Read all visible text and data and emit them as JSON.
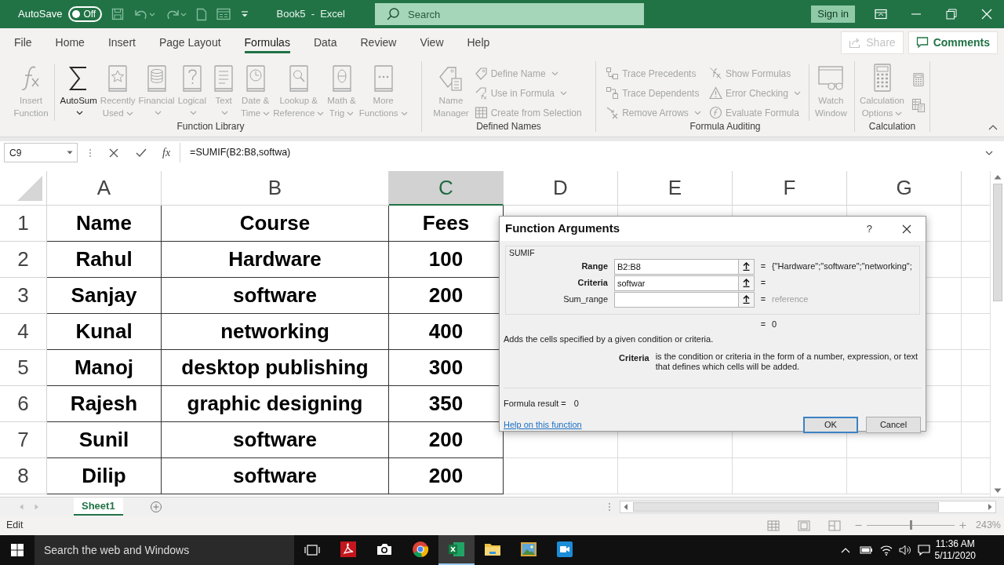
{
  "title_bar": {
    "autosave_label": "AutoSave",
    "autosave": {
      "label": "Off",
      "on": false
    },
    "document_title": "Book5  -  Excel",
    "search": {
      "placeholder": "Search"
    },
    "sign_in": "Sign in"
  },
  "ribbon_tabs": [
    {
      "label": "File",
      "selected": false
    },
    {
      "label": "Home",
      "selected": false
    },
    {
      "label": "Insert",
      "selected": false
    },
    {
      "label": "Page Layout",
      "selected": false
    },
    {
      "label": "Formulas",
      "selected": true
    },
    {
      "label": "Data",
      "selected": false
    },
    {
      "label": "Review",
      "selected": false
    },
    {
      "label": "View",
      "selected": false
    },
    {
      "label": "Help",
      "selected": false
    }
  ],
  "share": {
    "label": "Share",
    "disabled": true
  },
  "comments": {
    "label": "Comments"
  },
  "ribbon_groups": [
    {
      "label": "Function Library",
      "items": [
        {
          "kind": "large",
          "label": "Insert\nFunction",
          "disabled": true,
          "dropdown": false
        },
        {
          "kind": "divider"
        },
        {
          "kind": "large",
          "label": "AutoSum",
          "disabled": false,
          "dropdown": true
        },
        {
          "kind": "large",
          "label": "Recently\nUsed",
          "disabled": true,
          "dropdown": true
        },
        {
          "kind": "large",
          "label": "Financial",
          "disabled": true,
          "dropdown": true
        },
        {
          "kind": "large",
          "label": "Logical",
          "disabled": true,
          "dropdown": true
        },
        {
          "kind": "large",
          "label": "Text",
          "disabled": true,
          "dropdown": true
        },
        {
          "kind": "large",
          "label": "Date &\nTime",
          "disabled": true,
          "dropdown": true
        },
        {
          "kind": "large",
          "label": "Lookup &\nReference",
          "disabled": true,
          "dropdown": true
        },
        {
          "kind": "large",
          "label": "Math &\nTrig",
          "disabled": true,
          "dropdown": true
        },
        {
          "kind": "large",
          "label": "More\nFunctions",
          "disabled": true,
          "dropdown": true
        }
      ]
    },
    {
      "label": "Defined Names",
      "items": [
        {
          "kind": "large",
          "label": "Name\nManager",
          "disabled": true,
          "dropdown": false
        },
        {
          "kind": "stack",
          "items": [
            {
              "label": "Define Name",
              "disabled": true,
              "dropdown": true
            },
            {
              "label": "Use in Formula",
              "disabled": true,
              "dropdown": true
            },
            {
              "label": "Create from Selection",
              "disabled": true,
              "dropdown": false
            }
          ]
        }
      ]
    },
    {
      "label": "Formula Auditing",
      "items": [
        {
          "kind": "stack",
          "items": [
            {
              "label": "Trace Precedents",
              "disabled": true,
              "dropdown": false
            },
            {
              "label": "Trace Dependents",
              "disabled": true,
              "dropdown": false
            },
            {
              "label": "Remove Arrows",
              "disabled": true,
              "dropdown": true
            }
          ]
        },
        {
          "kind": "stack",
          "items": [
            {
              "label": "Show Formulas",
              "disabled": true,
              "dropdown": false
            },
            {
              "label": "Error Checking",
              "disabled": true,
              "dropdown": true
            },
            {
              "label": "Evaluate Formula",
              "disabled": true,
              "dropdown": false
            }
          ]
        },
        {
          "kind": "divider"
        },
        {
          "kind": "large",
          "label": "Watch\nWindow",
          "disabled": true,
          "dropdown": false
        }
      ]
    },
    {
      "label": "Calculation",
      "items": [
        {
          "kind": "large",
          "label": "Calculation\nOptions",
          "disabled": true,
          "dropdown": true
        },
        {
          "kind": "icon_stack"
        }
      ]
    }
  ],
  "formula_bar": {
    "name_box": "C9",
    "fx_label": "fx",
    "formula": "=SUMIF(B2:B8,softwa)"
  },
  "sheet": {
    "columns": [
      {
        "label": "A",
        "selected": false
      },
      {
        "label": "B",
        "selected": false
      },
      {
        "label": "C",
        "selected": true
      },
      {
        "label": "D",
        "selected": false
      },
      {
        "label": "E",
        "selected": false
      },
      {
        "label": "F",
        "selected": false
      },
      {
        "label": "G",
        "selected": false
      }
    ],
    "rows": [
      {
        "header": "1",
        "cells": [
          "Name",
          "Course",
          "Fees"
        ]
      },
      {
        "header": "2",
        "cells": [
          "Rahul",
          "Hardware",
          "100"
        ]
      },
      {
        "header": "3",
        "cells": [
          "Sanjay",
          "software",
          "200"
        ]
      },
      {
        "header": "4",
        "cells": [
          "Kunal",
          "networking",
          "400"
        ]
      },
      {
        "header": "5",
        "cells": [
          "Manoj",
          "desktop publishing",
          "300"
        ]
      },
      {
        "header": "6",
        "cells": [
          "Rajesh",
          "graphic designing",
          "350"
        ]
      },
      {
        "header": "7",
        "cells": [
          "Sunil",
          "software",
          "200"
        ]
      },
      {
        "header": "8",
        "cells": [
          "Dilip",
          "software",
          "200"
        ]
      }
    ]
  },
  "dialog": {
    "title": "Function Arguments",
    "help": "?",
    "function_name": "SUMIF",
    "arguments": [
      {
        "name": "Range",
        "required": true,
        "value": "B2:B8",
        "equals": "=",
        "result": "{\"Hardware\";\"software\";\"networking\";",
        "result_is_hint": false
      },
      {
        "name": "Criteria",
        "required": true,
        "value": "softwar",
        "equals": "="
      },
      {
        "name": "Sum_range",
        "required": false,
        "equals": "=",
        "result": "reference",
        "result_is_hint": true
      }
    ],
    "total": {
      "equals": "=",
      "value": "0"
    },
    "description": "Adds the cells specified by a given condition or criteria.",
    "argument_help": {
      "name": "Criteria",
      "text": "is the condition or criteria in the form of a number, expression, or text that defines which cells will be added."
    },
    "formula_result_label": "Formula result =",
    "formula_result_value": "0",
    "help_link": "Help on this function",
    "buttons": [
      {
        "label": "OK",
        "default": true
      },
      {
        "label": "Cancel",
        "default": false
      }
    ]
  },
  "sheet_tabs": [
    {
      "label": "Sheet1",
      "selected": true
    }
  ],
  "status_bar": {
    "mode": "Edit",
    "zoom": "243%",
    "zoom_slider": {
      "level": 0.5
    }
  },
  "taskbar": {
    "search": {
      "placeholder": "Search the web and Windows"
    },
    "apps": [
      {
        "selected": false
      },
      {
        "selected": false
      },
      {
        "selected": false
      },
      {
        "selected": true
      },
      {
        "selected": false
      },
      {
        "selected": false
      },
      {
        "selected": false
      }
    ],
    "time": "11:36 AM",
    "date": "5/11/2020"
  }
}
